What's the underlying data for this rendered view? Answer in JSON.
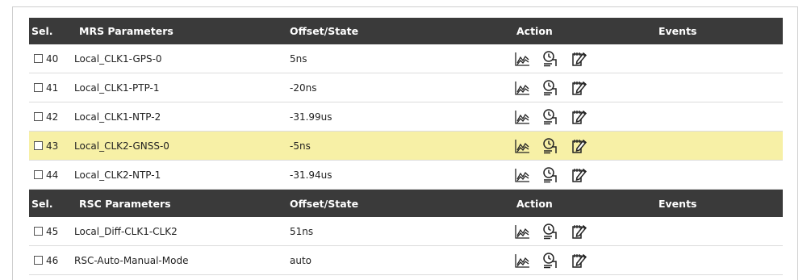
{
  "mrs_header": {
    "sel": "Sel.",
    "params": "MRS Parameters",
    "offset": "Offset/State",
    "action": "Action",
    "events": "Events"
  },
  "mrs_rows": [
    {
      "index": "40",
      "name": "Local_CLK1-GPS-0",
      "value": "5ns",
      "highlighted": false
    },
    {
      "index": "41",
      "name": "Local_CLK1-PTP-1",
      "value": "-20ns",
      "highlighted": false
    },
    {
      "index": "42",
      "name": "Local_CLK1-NTP-2",
      "value": "-31.99us",
      "highlighted": false
    },
    {
      "index": "43",
      "name": "Local_CLK2-GNSS-0",
      "value": "-5ns",
      "highlighted": true
    },
    {
      "index": "44",
      "name": "Local_CLK2-NTP-1",
      "value": "-31.94us",
      "highlighted": false
    }
  ],
  "rsc_header": {
    "sel": "Sel.",
    "params": "RSC Parameters",
    "offset": "Offset/State",
    "action": "Action",
    "events": "Events"
  },
  "rsc_rows": [
    {
      "index": "45",
      "name": "Local_Diff-CLK1-CLK2",
      "value": "51ns",
      "highlighted": false
    },
    {
      "index": "46",
      "name": "RSC-Auto-Manual-Mode",
      "value": "auto",
      "highlighted": false
    }
  ],
  "icons": [
    "chart-icon",
    "alarm-clock-icon",
    "edit-notes-icon"
  ],
  "colors": {
    "header_bg": "#3a3a3a",
    "highlight": "#f7f0a6"
  }
}
